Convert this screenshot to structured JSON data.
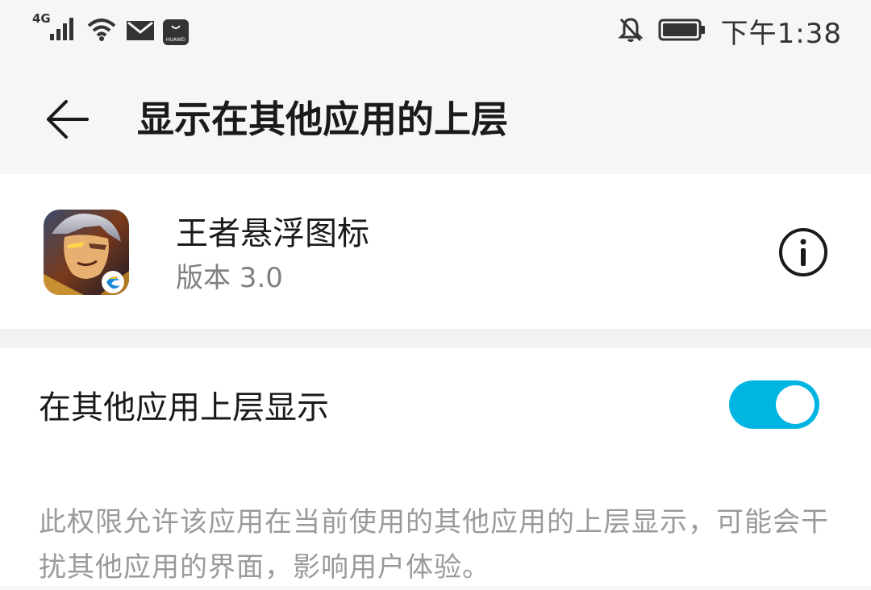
{
  "status_bar": {
    "network_type": "4G",
    "clock": "下午1:38",
    "icons": [
      "signal-icon",
      "wifi-icon",
      "mail-icon",
      "huawei-appgallery-icon",
      "notifications-off-icon",
      "battery-icon"
    ],
    "appgallery_text": "HUAWEI"
  },
  "header": {
    "back_icon": "arrow-left-icon",
    "title": "显示在其他应用的上层"
  },
  "app": {
    "name": "王者悬浮图标",
    "version": "版本 3.0",
    "info_icon": "info-icon"
  },
  "permission": {
    "label": "在其他应用上层显示",
    "enabled": true,
    "description": "此权限允许该应用在当前使用的其他应用的上层显示，可能会干扰其他应用的界面，影响用户体验。"
  },
  "colors": {
    "accent": "#00b5e2",
    "background": "#f6f6f6",
    "card": "#ffffff",
    "secondary_text": "#808080"
  }
}
